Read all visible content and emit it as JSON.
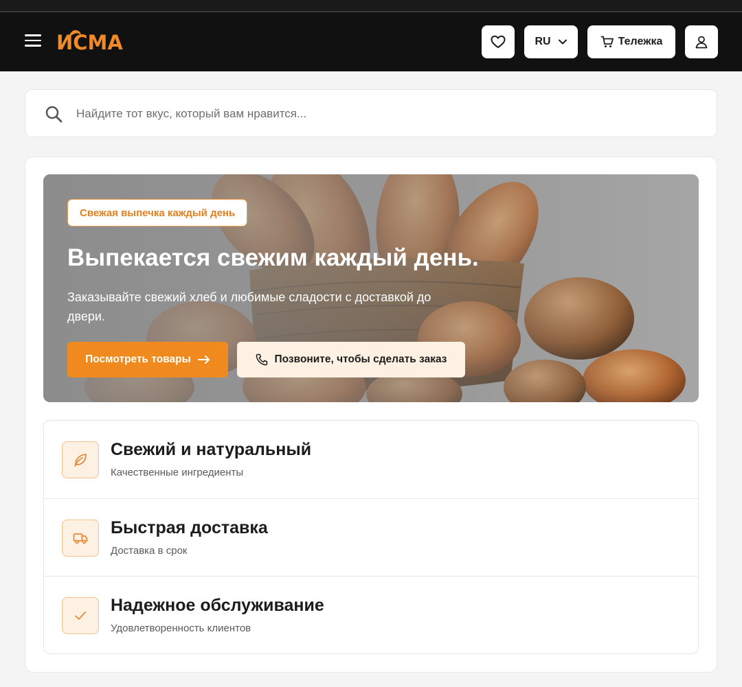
{
  "header": {
    "logo_text": "ИСМА",
    "language": "RU",
    "cart_label": "Тележка"
  },
  "search": {
    "placeholder": "Найдите тот вкус, который вам нравится..."
  },
  "hero": {
    "badge": "Свежая выпечка каждый день",
    "title": "Выпекается свежим каждый день.",
    "description": "Заказывайте свежий хлеб и любимые сладости с доставкой до двери.",
    "primary_button": "Посмотреть товары",
    "secondary_button": "Позвоните, чтобы сделать заказ"
  },
  "features": [
    {
      "icon": "leaf-icon",
      "title": "Свежий и натуральный",
      "subtitle": "Качественные ингредиенты"
    },
    {
      "icon": "truck-icon",
      "title": "Быстрая доставка",
      "subtitle": "Доставка в срок"
    },
    {
      "icon": "check-icon",
      "title": "Надежное обслуживание",
      "subtitle": "Удовлетворенность клиентов"
    }
  ],
  "colors": {
    "accent": "#f08a1e",
    "header_bg": "#111111",
    "accent_soft": "#fdf1e4"
  }
}
